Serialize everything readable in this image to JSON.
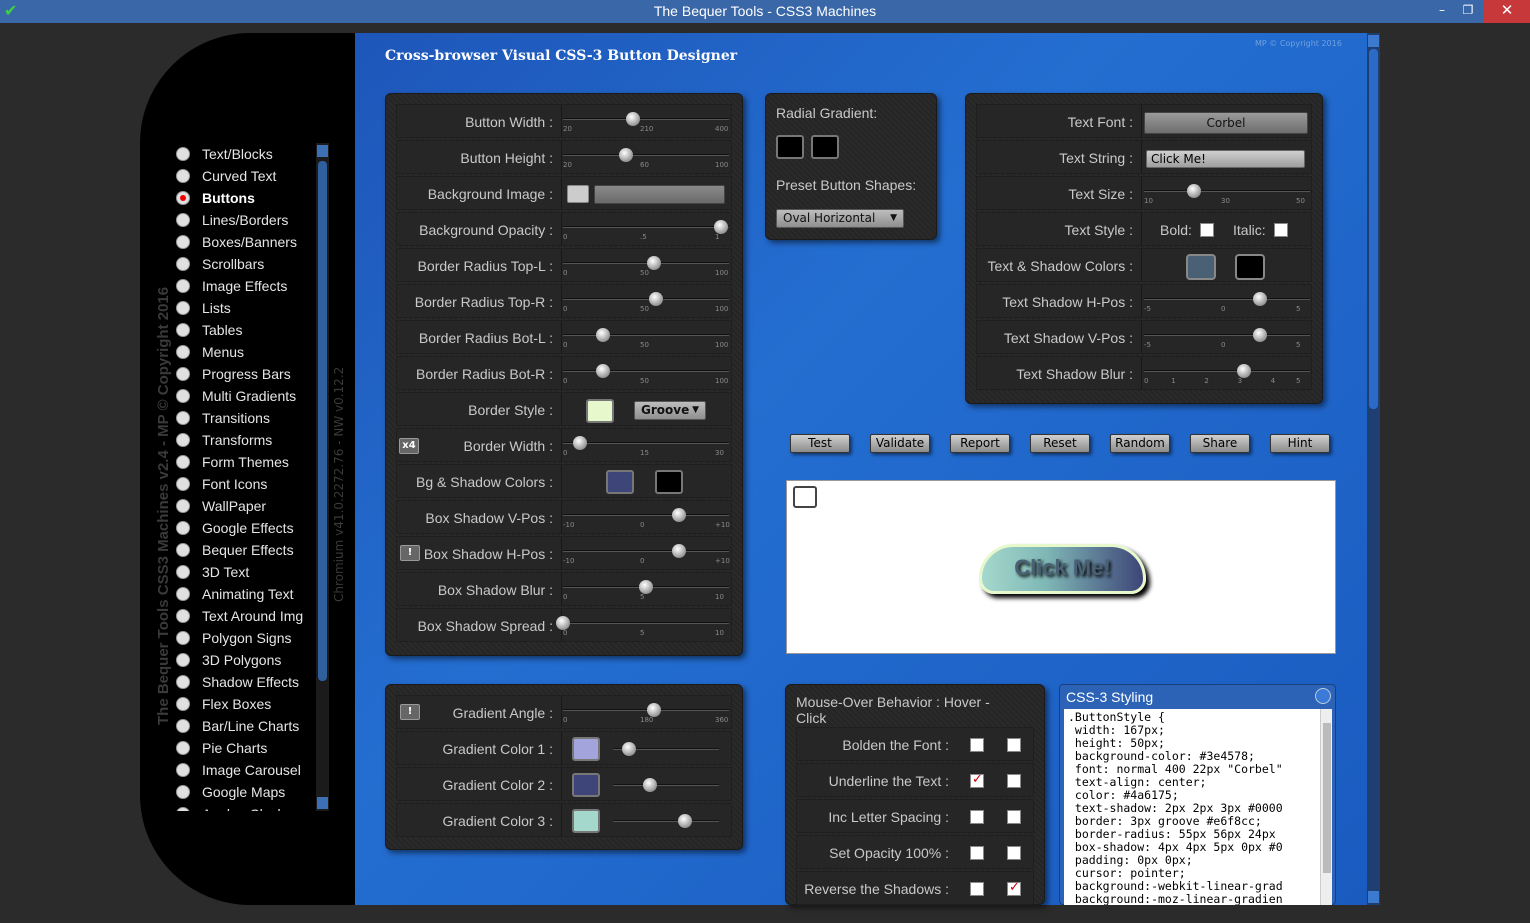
{
  "window": {
    "title": "The Bequer Tools - CSS3 Machines",
    "min": "–",
    "max": "❐",
    "close": "✕",
    "check": "✔"
  },
  "sidebar": {
    "vertical_title": "The Bequer Tools CSS3 Machines v2.4 - MP © Copyright 2016",
    "vertical_version": "Chromium v41.0.2272.76 - NW v0.12.2",
    "items": [
      "Text/Blocks",
      "Curved Text",
      "Buttons",
      "Lines/Borders",
      "Boxes/Banners",
      "Scrollbars",
      "Image Effects",
      "Lists",
      "Tables",
      "Menus",
      "Progress Bars",
      "Multi Gradients",
      "Transitions",
      "Transforms",
      "Form Themes",
      "Font Icons",
      "WallPaper",
      "Google Effects",
      "Bequer Effects",
      "3D Text",
      "Animating Text",
      "Text Around Img",
      "Polygon Signs",
      "3D Polygons",
      "Shadow Effects",
      "Flex Boxes",
      "Bar/Line Charts",
      "Pie Charts",
      "Image Carousel",
      "Google Maps",
      "Analog Clocks"
    ],
    "active": "Buttons"
  },
  "header": {
    "title": "Cross-browser Visual CSS-3 Button Designer",
    "copyright": "MP © Copyright 2016"
  },
  "left_panel": {
    "button_width": {
      "label": "Button Width :",
      "ticks": [
        "20",
        "210",
        "400"
      ],
      "value": 0.42
    },
    "button_height": {
      "label": "Button Height :",
      "ticks": [
        "20",
        "60",
        "100"
      ],
      "value": 0.38
    },
    "background_image": {
      "label": "Background Image :"
    },
    "background_opacity": {
      "label": "Background Opacity :",
      "ticks": [
        "0",
        ".5",
        "1"
      ],
      "value": 0.95
    },
    "br_tl": {
      "label": "Border Radius Top-L :",
      "ticks": [
        "0",
        "50",
        "100"
      ],
      "value": 0.55
    },
    "br_tr": {
      "label": "Border Radius Top-R :",
      "ticks": [
        "0",
        "50",
        "100"
      ],
      "value": 0.56
    },
    "br_bl": {
      "label": "Border Radius Bot-L :",
      "ticks": [
        "0",
        "50",
        "100"
      ],
      "value": 0.24
    },
    "br_br": {
      "label": "Border Radius Bot-R :",
      "ticks": [
        "0",
        "50",
        "100"
      ],
      "value": 0.24
    },
    "border_style": {
      "label": "Border Style :",
      "value": "Groove"
    },
    "x4": "x4",
    "border_width": {
      "label": "Border Width :",
      "ticks": [
        "0",
        "15",
        "30"
      ],
      "value": 0.1
    },
    "bg_shadow_colors": {
      "label": "Bg & Shadow Colors :"
    },
    "box_shadow_v": {
      "label": "Box Shadow V-Pos :",
      "ticks": [
        "-10",
        "0",
        "+10"
      ],
      "value": 0.7
    },
    "excl": "!",
    "box_shadow_h": {
      "label": "Box Shadow H-Pos :",
      "ticks": [
        "-10",
        "0",
        "+10"
      ],
      "value": 0.7
    },
    "box_shadow_blur": {
      "label": "Box Shadow Blur :",
      "ticks": [
        "0",
        "5",
        "10"
      ],
      "value": 0.5
    },
    "box_shadow_spread": {
      "label": "Box Shadow Spread :",
      "ticks": [
        "0",
        "5",
        "10"
      ],
      "value": 0.0
    }
  },
  "gradient_panel": {
    "angle": {
      "label": "Gradient Angle :",
      "ticks": [
        "0",
        "180",
        "360"
      ],
      "value": 0.55
    },
    "c1": {
      "label": "Gradient Color 1 :",
      "value": 0.15,
      "color": "#a4a4dc"
    },
    "c2": {
      "label": "Gradient Color 2 :",
      "value": 0.35,
      "color": "#3e4578"
    },
    "c3": {
      "label": "Gradient Color 3 :",
      "value": 0.68,
      "color": "#a4d8cc"
    }
  },
  "radial_panel": {
    "radial_label": "Radial Gradient:",
    "preset_label": "Preset Button Shapes:",
    "preset_value": "Oval Horizontal"
  },
  "text_panel": {
    "font": {
      "label": "Text Font :",
      "value": "Corbel"
    },
    "string": {
      "label": "Text String :",
      "value": "Click Me!"
    },
    "size": {
      "label": "Text Size :",
      "ticks": [
        "10",
        "30",
        "50"
      ],
      "value": 0.3
    },
    "style": {
      "label": "Text Style :",
      "bold": "Bold:",
      "italic": "Italic:"
    },
    "colors": {
      "label": "Text & Shadow Colors :"
    },
    "shadow_h": {
      "label": "Text Shadow H-Pos :",
      "ticks": [
        "-5",
        "0",
        "5"
      ],
      "value": 0.7
    },
    "shadow_v": {
      "label": "Text Shadow V-Pos :",
      "ticks": [
        "-5",
        "0",
        "5"
      ],
      "value": 0.7
    },
    "shadow_blur": {
      "label": "Text Shadow Blur :",
      "ticks": [
        "0",
        "1",
        "2",
        "3",
        "4",
        "5"
      ],
      "value": 0.6
    }
  },
  "actions": [
    "Test",
    "Validate",
    "Report",
    "Reset",
    "Random",
    "Share",
    "Hint"
  ],
  "preview": {
    "button_text": "Click Me!"
  },
  "mouseover": {
    "title": "Mouse-Over Behavior :  Hover - Click",
    "rows": [
      {
        "label": "Bolden the Font :",
        "hover": false,
        "click": false
      },
      {
        "label": "Underline the Text :",
        "hover": true,
        "click": false
      },
      {
        "label": "Inc Letter Spacing :",
        "hover": false,
        "click": false
      },
      {
        "label": "Set Opacity 100% :",
        "hover": false,
        "click": false
      },
      {
        "label": "Reverse the Shadows :",
        "hover": false,
        "click": true
      }
    ]
  },
  "css": {
    "title": "CSS-3 Styling",
    "code": ".ButtonStyle {\n width: 167px;\n height: 50px;\n background-color: #3e4578;\n font: normal 400 22px \"Corbel\"\n text-align: center;\n color: #4a6175;\n text-shadow: 2px 2px 3px #0000\n border: 3px groove #e6f8cc;\n border-radius: 55px 56px 24px\n box-shadow: 4px 4px 5px 0px #0\n padding: 0px 0px;\n cursor: pointer;\n background:-webkit-linear-grad\n background:-moz-linear-gradien"
  }
}
